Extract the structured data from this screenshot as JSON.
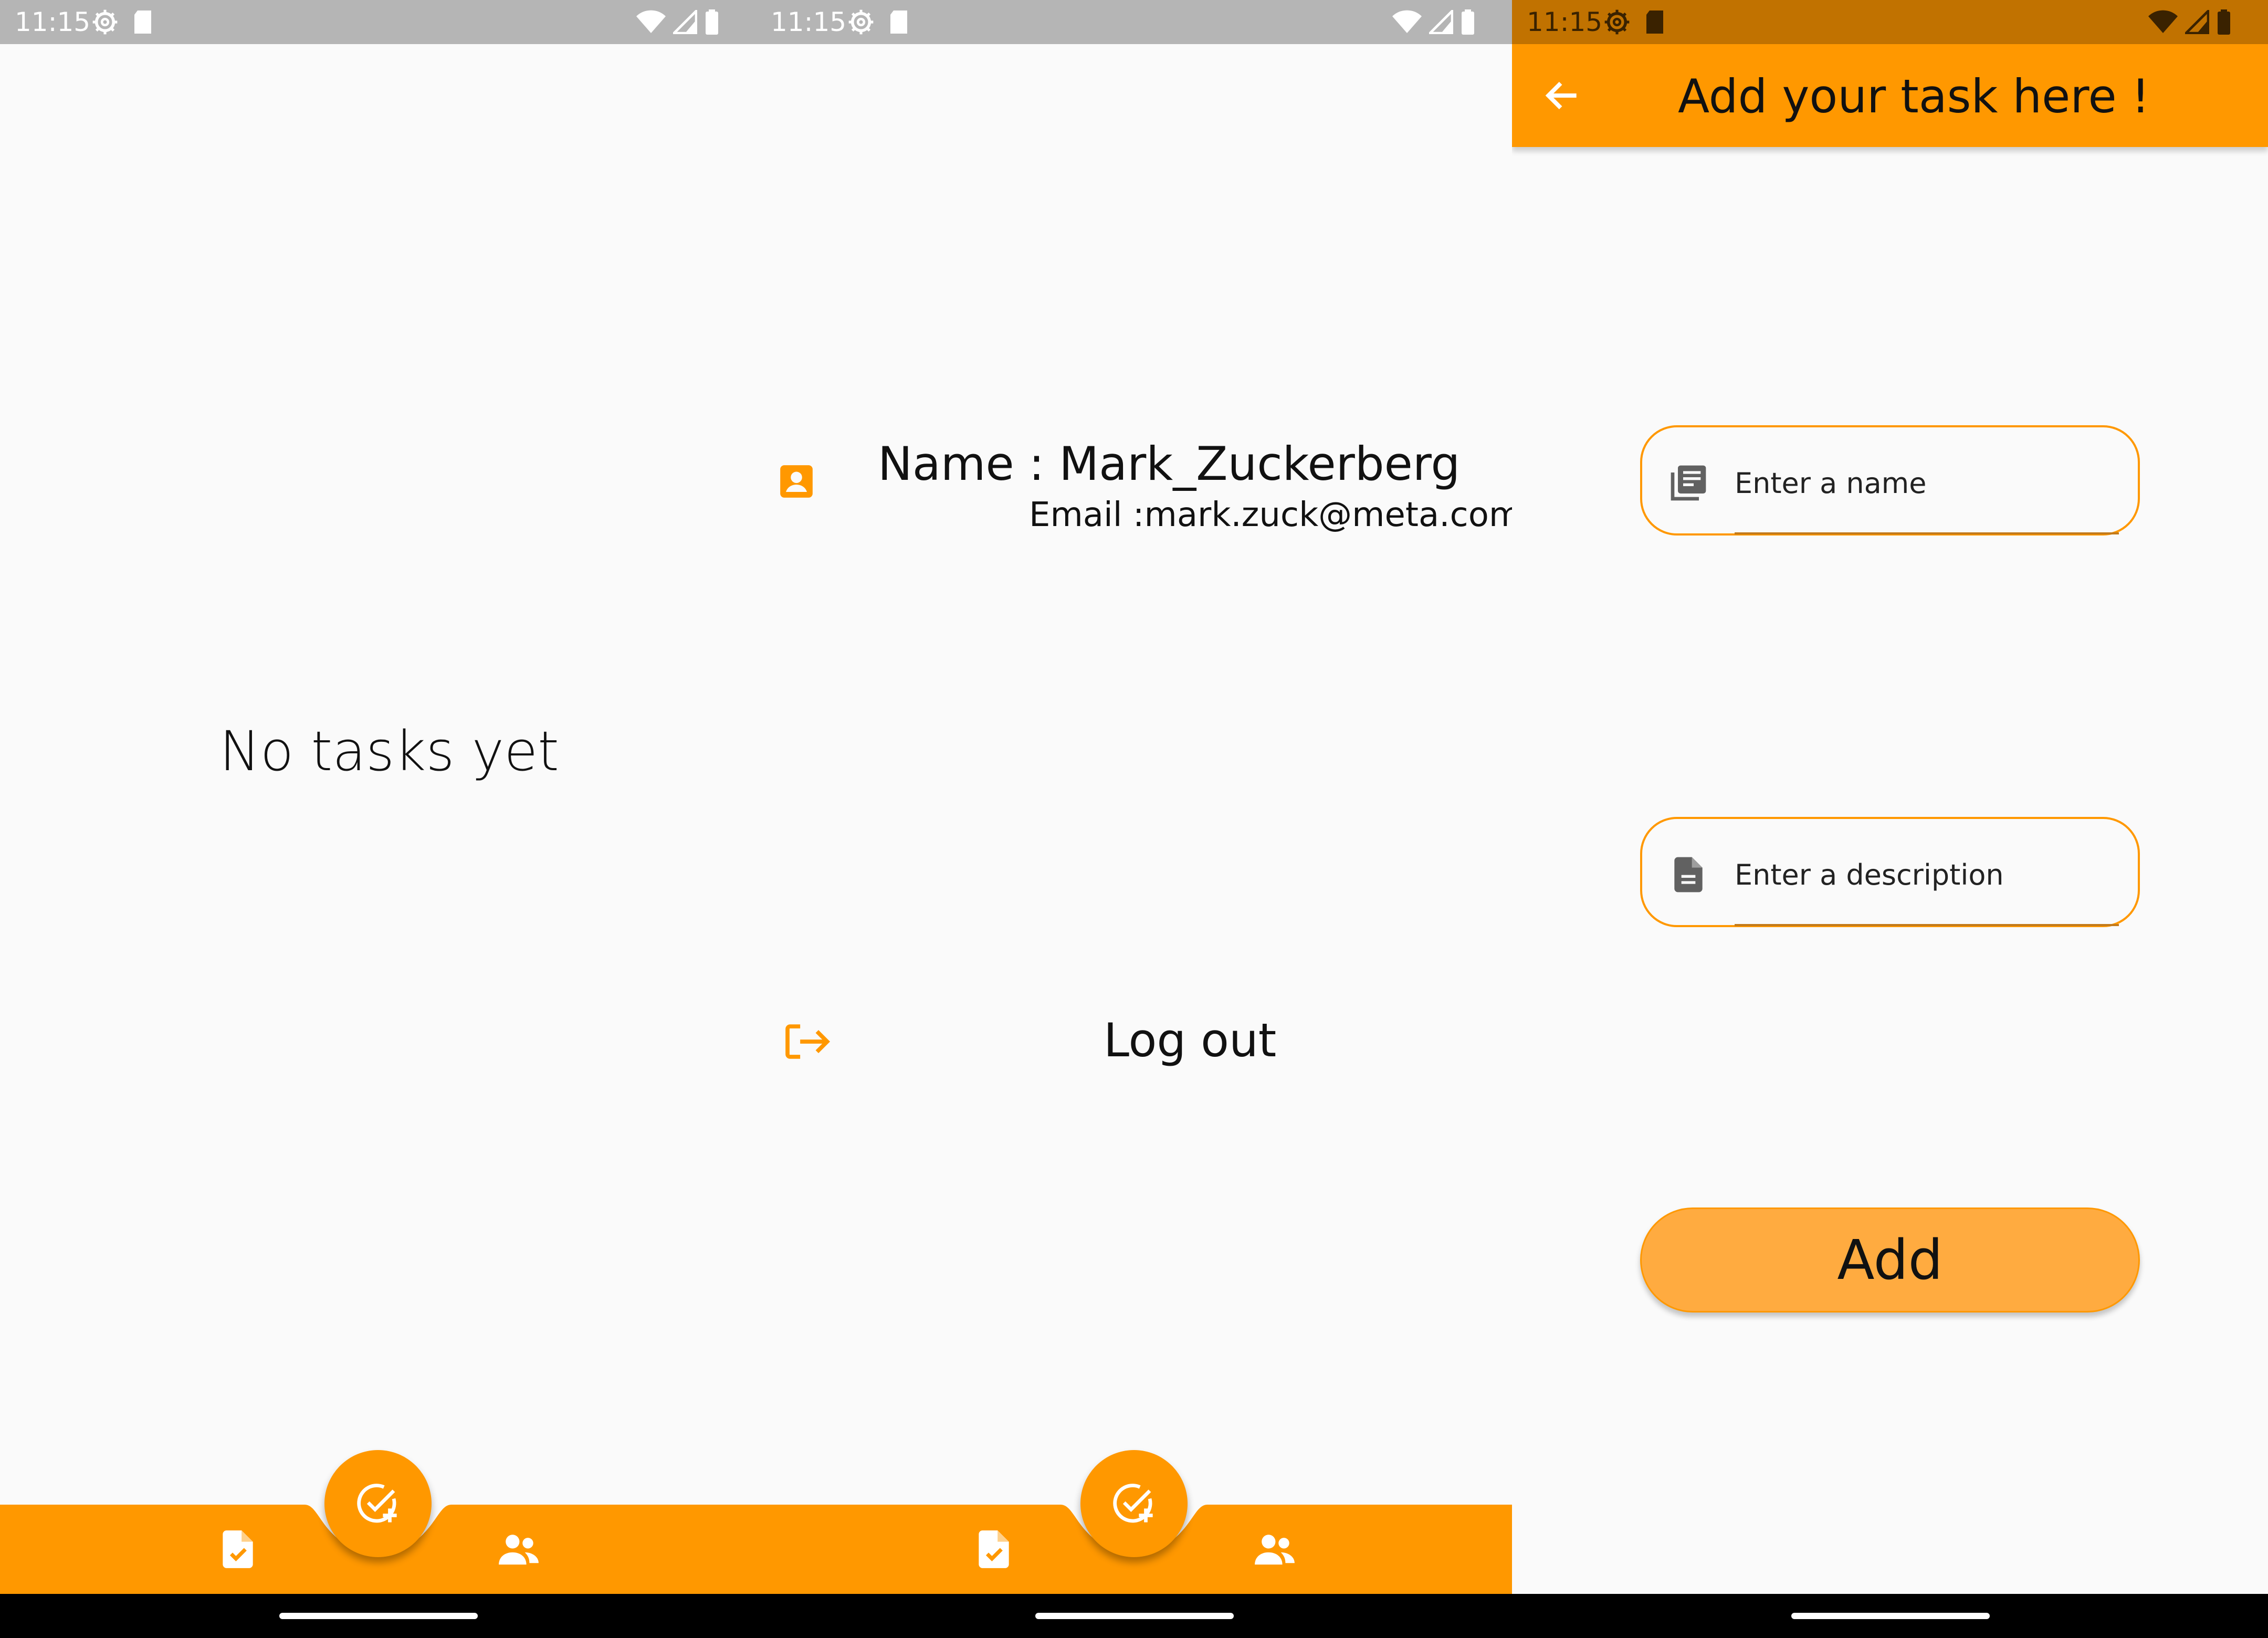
{
  "status_bar": {
    "time": "11:15"
  },
  "colors": {
    "accent": "#ff9800",
    "button": "#ffab40",
    "status_gray": "#b5b5b5",
    "status_dark_orange": "#c17200",
    "background": "#fafafa"
  },
  "icons": {
    "tasks_tab": "task-document-check-icon",
    "users_tab": "people-icon",
    "fab": "add-task-check-icon",
    "profile": "contact-card-icon",
    "logout": "logout-icon",
    "back": "arrow-back-icon",
    "name_field": "list-document-icon",
    "description_field": "description-document-icon"
  },
  "screen_tasks": {
    "empty_message": "No tasks yet"
  },
  "screen_profile": {
    "name_line": "Name : Mark_Zuckerberg",
    "email_line": "Email :mark.zuck@meta.com",
    "logout_label": "Log out"
  },
  "screen_add_task": {
    "title": "Add your task here !",
    "name_placeholder": "Enter a name",
    "description_placeholder": "Enter a description",
    "add_label": "Add"
  }
}
